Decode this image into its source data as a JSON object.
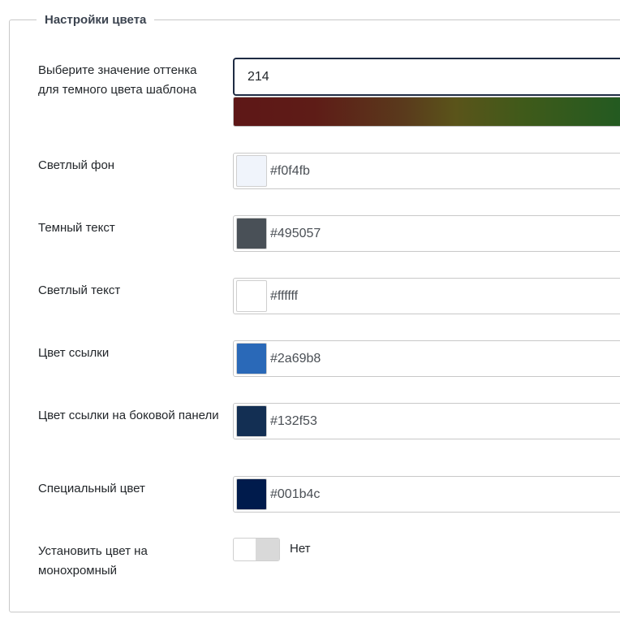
{
  "fieldset": {
    "legend": "Настройки цвета"
  },
  "hue": {
    "label": "Выберите значение оттенка для темного цвета шаблона",
    "value": "214"
  },
  "colors": [
    {
      "label": "Светлый фон",
      "value": "#f0f4fb",
      "swatch": "#f0f4fb"
    },
    {
      "label": "Темный текст",
      "value": "#495057",
      "swatch": "#495057"
    },
    {
      "label": "Светлый текст",
      "value": "#ffffff",
      "swatch": "#ffffff"
    },
    {
      "label": "Цвет ссылки",
      "value": "#2a69b8",
      "swatch": "#2a69b8"
    },
    {
      "label": "Цвет ссылки на боковой панели",
      "value": "#132f53",
      "swatch": "#132f53"
    },
    {
      "label": "Специальный цвет",
      "value": "#001b4c",
      "swatch": "#001b4c"
    }
  ],
  "monochrome": {
    "label": "Установить цвет на монохромный",
    "state": "Нет"
  }
}
